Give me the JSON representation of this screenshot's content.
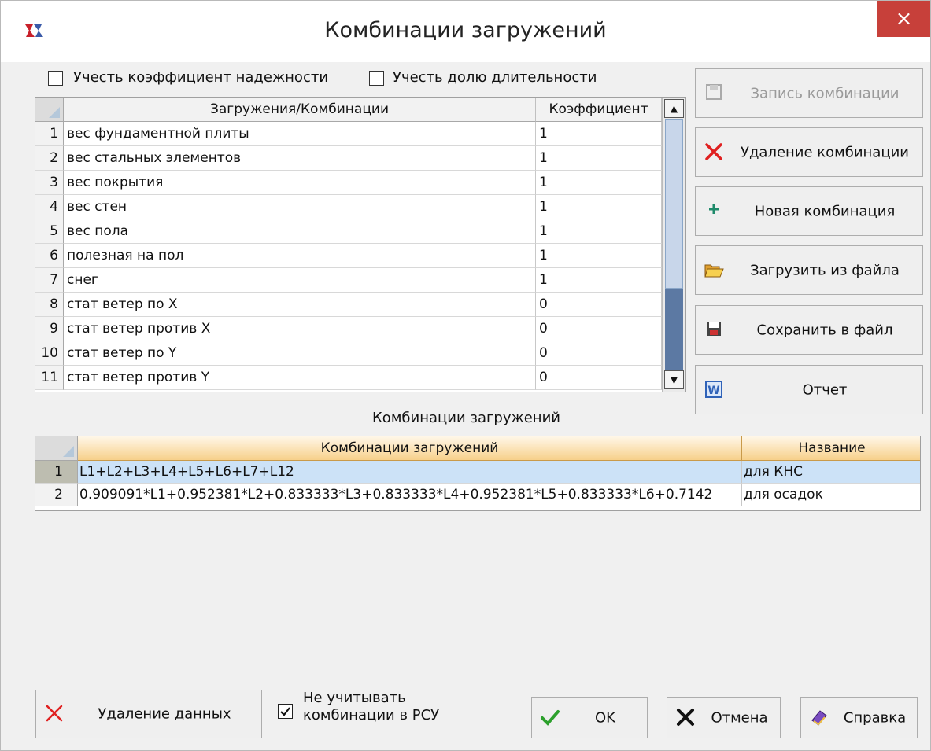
{
  "window": {
    "title": "Комбинации загружений",
    "close_glyph": "×"
  },
  "options": {
    "reliability_label": "Учесть коэффициент надежности",
    "reliability_checked": false,
    "duration_label": "Учесть долю длительности",
    "duration_checked": false
  },
  "loads_table": {
    "columns": [
      "Загружения/Комбинации",
      "Коэффициент"
    ],
    "rows": [
      {
        "n": "1",
        "name": "вес фундаментной плиты",
        "coef": "1"
      },
      {
        "n": "2",
        "name": "вес стальных элементов",
        "coef": "1"
      },
      {
        "n": "3",
        "name": "вес покрытия",
        "coef": "1"
      },
      {
        "n": "4",
        "name": "вес стен",
        "coef": "1"
      },
      {
        "n": "5",
        "name": "вес пола",
        "coef": "1"
      },
      {
        "n": "6",
        "name": "полезная на пол",
        "coef": "1"
      },
      {
        "n": "7",
        "name": "снег",
        "coef": "1"
      },
      {
        "n": "8",
        "name": "стат ветер по X",
        "coef": "0"
      },
      {
        "n": "9",
        "name": "стат ветер против X",
        "coef": "0"
      },
      {
        "n": "10",
        "name": "стат ветер по Y",
        "coef": "0"
      },
      {
        "n": "11",
        "name": "стат ветер против Y",
        "coef": "0"
      }
    ]
  },
  "side_buttons": {
    "record": "Запись комбинации",
    "delete": "Удаление комбинации",
    "new": "Новая комбинация",
    "load": "Загрузить из файла",
    "save": "Сохранить в файл",
    "report": "Отчет"
  },
  "combos": {
    "section_title": "Комбинации загружений",
    "columns": [
      "Комбинации загружений",
      "Название"
    ],
    "rows": [
      {
        "n": "1",
        "formula": "L1+L2+L3+L4+L5+L6+L7+L12",
        "name": "для КНС",
        "selected": true
      },
      {
        "n": "2",
        "formula": "0.909091*L1+0.952381*L2+0.833333*L3+0.833333*L4+0.952381*L5+0.833333*L6+0.7142",
        "name": "для осадок",
        "selected": false
      }
    ]
  },
  "footer": {
    "delete_data": "Удаление данных",
    "ignore_line1": "Не учитывать",
    "ignore_line2": "комбинации в РСУ",
    "ignore_checked": true,
    "ok": "OK",
    "cancel": "Отмена",
    "help": "Справка"
  },
  "colors": {
    "close": "#c7403a",
    "header_orange": "#f7d08a",
    "selection": "#cce2f7",
    "delete_red": "#e02020",
    "ok_green": "#2ca02c"
  }
}
